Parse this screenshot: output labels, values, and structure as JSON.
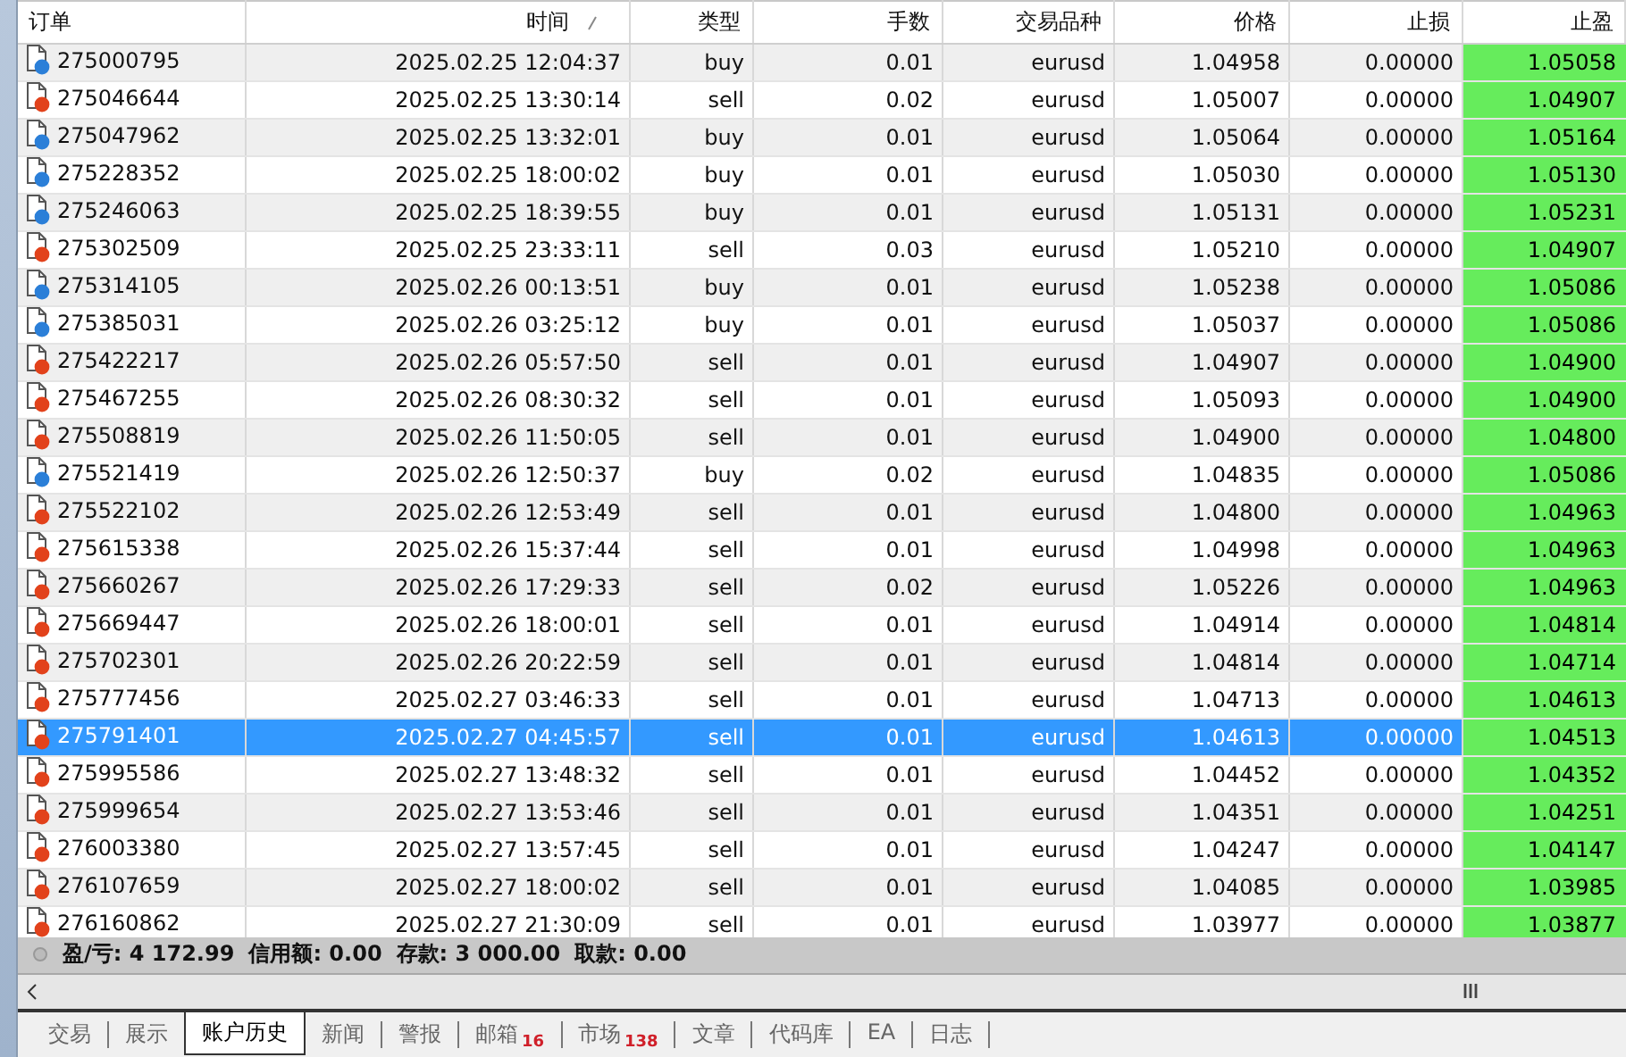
{
  "table": {
    "columns": [
      {
        "label": "订单",
        "sorted": false
      },
      {
        "label": "时间",
        "sorted": true
      },
      {
        "label": "类型",
        "sorted": false
      },
      {
        "label": "手数",
        "sorted": false
      },
      {
        "label": "交易品种",
        "sorted": false
      },
      {
        "label": "价格",
        "sorted": false
      },
      {
        "label": "止损",
        "sorted": false
      },
      {
        "label": "止盈",
        "sorted": false
      }
    ],
    "rows": [
      {
        "order": "275000795",
        "time": "2025.02.25 12:04:37",
        "type": "buy",
        "lots": "0.01",
        "symbol": "eurusd",
        "price": "1.04958",
        "sl": "0.00000",
        "tp": "1.05058",
        "color": "#2b7fd8",
        "selected": false
      },
      {
        "order": "275046644",
        "time": "2025.02.25 13:30:14",
        "type": "sell",
        "lots": "0.02",
        "symbol": "eurusd",
        "price": "1.05007",
        "sl": "0.00000",
        "tp": "1.04907",
        "color": "#e2421b",
        "selected": false
      },
      {
        "order": "275047962",
        "time": "2025.02.25 13:32:01",
        "type": "buy",
        "lots": "0.01",
        "symbol": "eurusd",
        "price": "1.05064",
        "sl": "0.00000",
        "tp": "1.05164",
        "color": "#2b7fd8",
        "selected": false
      },
      {
        "order": "275228352",
        "time": "2025.02.25 18:00:02",
        "type": "buy",
        "lots": "0.01",
        "symbol": "eurusd",
        "price": "1.05030",
        "sl": "0.00000",
        "tp": "1.05130",
        "color": "#2b7fd8",
        "selected": false
      },
      {
        "order": "275246063",
        "time": "2025.02.25 18:39:55",
        "type": "buy",
        "lots": "0.01",
        "symbol": "eurusd",
        "price": "1.05131",
        "sl": "0.00000",
        "tp": "1.05231",
        "color": "#2b7fd8",
        "selected": false
      },
      {
        "order": "275302509",
        "time": "2025.02.25 23:33:11",
        "type": "sell",
        "lots": "0.03",
        "symbol": "eurusd",
        "price": "1.05210",
        "sl": "0.00000",
        "tp": "1.04907",
        "color": "#e2421b",
        "selected": false
      },
      {
        "order": "275314105",
        "time": "2025.02.26 00:13:51",
        "type": "buy",
        "lots": "0.01",
        "symbol": "eurusd",
        "price": "1.05238",
        "sl": "0.00000",
        "tp": "1.05086",
        "color": "#2b7fd8",
        "selected": false
      },
      {
        "order": "275385031",
        "time": "2025.02.26 03:25:12",
        "type": "buy",
        "lots": "0.01",
        "symbol": "eurusd",
        "price": "1.05037",
        "sl": "0.00000",
        "tp": "1.05086",
        "color": "#2b7fd8",
        "selected": false
      },
      {
        "order": "275422217",
        "time": "2025.02.26 05:57:50",
        "type": "sell",
        "lots": "0.01",
        "symbol": "eurusd",
        "price": "1.04907",
        "sl": "0.00000",
        "tp": "1.04900",
        "color": "#e2421b",
        "selected": false
      },
      {
        "order": "275467255",
        "time": "2025.02.26 08:30:32",
        "type": "sell",
        "lots": "0.01",
        "symbol": "eurusd",
        "price": "1.05093",
        "sl": "0.00000",
        "tp": "1.04900",
        "color": "#e2421b",
        "selected": false
      },
      {
        "order": "275508819",
        "time": "2025.02.26 11:50:05",
        "type": "sell",
        "lots": "0.01",
        "symbol": "eurusd",
        "price": "1.04900",
        "sl": "0.00000",
        "tp": "1.04800",
        "color": "#e2421b",
        "selected": false
      },
      {
        "order": "275521419",
        "time": "2025.02.26 12:50:37",
        "type": "buy",
        "lots": "0.02",
        "symbol": "eurusd",
        "price": "1.04835",
        "sl": "0.00000",
        "tp": "1.05086",
        "color": "#2b7fd8",
        "selected": false
      },
      {
        "order": "275522102",
        "time": "2025.02.26 12:53:49",
        "type": "sell",
        "lots": "0.01",
        "symbol": "eurusd",
        "price": "1.04800",
        "sl": "0.00000",
        "tp": "1.04963",
        "color": "#e2421b",
        "selected": false
      },
      {
        "order": "275615338",
        "time": "2025.02.26 15:37:44",
        "type": "sell",
        "lots": "0.01",
        "symbol": "eurusd",
        "price": "1.04998",
        "sl": "0.00000",
        "tp": "1.04963",
        "color": "#e2421b",
        "selected": false
      },
      {
        "order": "275660267",
        "time": "2025.02.26 17:29:33",
        "type": "sell",
        "lots": "0.02",
        "symbol": "eurusd",
        "price": "1.05226",
        "sl": "0.00000",
        "tp": "1.04963",
        "color": "#e2421b",
        "selected": false
      },
      {
        "order": "275669447",
        "time": "2025.02.26 18:00:01",
        "type": "sell",
        "lots": "0.01",
        "symbol": "eurusd",
        "price": "1.04914",
        "sl": "0.00000",
        "tp": "1.04814",
        "color": "#e2421b",
        "selected": false
      },
      {
        "order": "275702301",
        "time": "2025.02.26 20:22:59",
        "type": "sell",
        "lots": "0.01",
        "symbol": "eurusd",
        "price": "1.04814",
        "sl": "0.00000",
        "tp": "1.04714",
        "color": "#e2421b",
        "selected": false
      },
      {
        "order": "275777456",
        "time": "2025.02.27 03:46:33",
        "type": "sell",
        "lots": "0.01",
        "symbol": "eurusd",
        "price": "1.04713",
        "sl": "0.00000",
        "tp": "1.04613",
        "color": "#e2421b",
        "selected": false
      },
      {
        "order": "275791401",
        "time": "2025.02.27 04:45:57",
        "type": "sell",
        "lots": "0.01",
        "symbol": "eurusd",
        "price": "1.04613",
        "sl": "0.00000",
        "tp": "1.04513",
        "color": "#e2421b",
        "selected": true
      },
      {
        "order": "275995586",
        "time": "2025.02.27 13:48:32",
        "type": "sell",
        "lots": "0.01",
        "symbol": "eurusd",
        "price": "1.04452",
        "sl": "0.00000",
        "tp": "1.04352",
        "color": "#e2421b",
        "selected": false
      },
      {
        "order": "275999654",
        "time": "2025.02.27 13:53:46",
        "type": "sell",
        "lots": "0.01",
        "symbol": "eurusd",
        "price": "1.04351",
        "sl": "0.00000",
        "tp": "1.04251",
        "color": "#e2421b",
        "selected": false
      },
      {
        "order": "276003380",
        "time": "2025.02.27 13:57:45",
        "type": "sell",
        "lots": "0.01",
        "symbol": "eurusd",
        "price": "1.04247",
        "sl": "0.00000",
        "tp": "1.04147",
        "color": "#e2421b",
        "selected": false
      },
      {
        "order": "276107659",
        "time": "2025.02.27 18:00:02",
        "type": "sell",
        "lots": "0.01",
        "symbol": "eurusd",
        "price": "1.04085",
        "sl": "0.00000",
        "tp": "1.03985",
        "color": "#e2421b",
        "selected": false
      },
      {
        "order": "276160862",
        "time": "2025.02.27 21:30:09",
        "type": "sell",
        "lots": "0.01",
        "symbol": "eurusd",
        "price": "1.03977",
        "sl": "0.00000",
        "tp": "1.03877",
        "color": "#e2421b",
        "selected": false
      }
    ]
  },
  "summary": [
    "盈/亏: 4 172.99",
    "信用额: 0.00",
    "存款: 3 000.00",
    "取款: 0.00"
  ],
  "tabs": [
    {
      "label": "交易",
      "selected": false
    },
    {
      "label": "展示",
      "selected": false
    },
    {
      "label": "账户历史",
      "selected": true
    },
    {
      "label": "新闻",
      "selected": false
    },
    {
      "label": "警报",
      "selected": false
    },
    {
      "label": "邮箱",
      "badge": "16",
      "selected": false
    },
    {
      "label": "市场",
      "badge": "138",
      "selected": false
    },
    {
      "label": "文章",
      "selected": false
    },
    {
      "label": "代码库",
      "selected": false
    },
    {
      "label": "EA",
      "selected": false
    },
    {
      "label": "日志",
      "selected": false
    }
  ]
}
